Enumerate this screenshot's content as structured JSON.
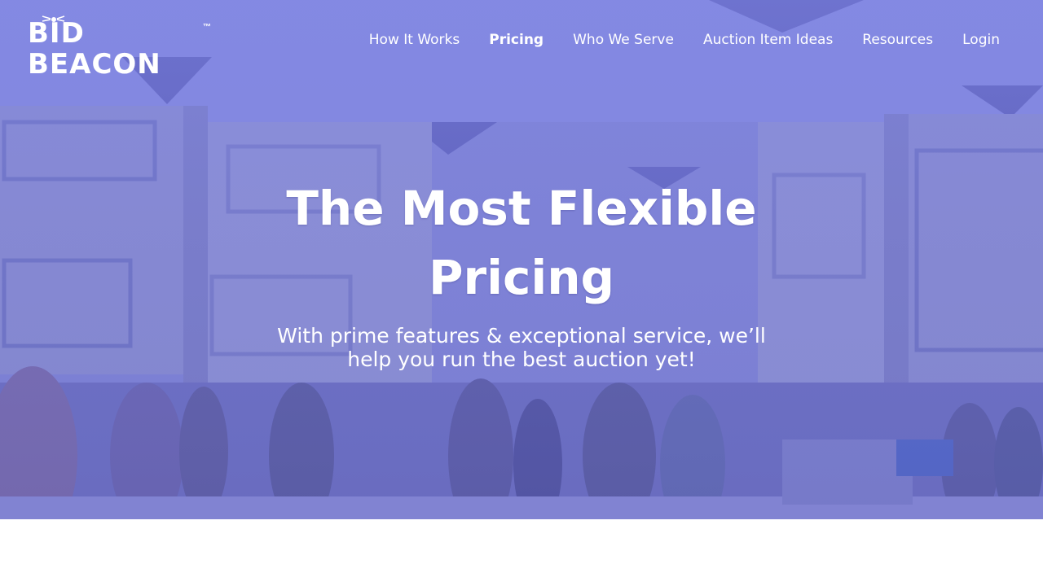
{
  "brand": {
    "logo_text": "BID BEACON",
    "trademark": "™"
  },
  "nav": {
    "items": [
      {
        "label": "How It Works",
        "active": false
      },
      {
        "label": "Pricing",
        "active": true
      },
      {
        "label": "Who We Serve",
        "active": false
      },
      {
        "label": "Auction Item Ideas",
        "active": false
      },
      {
        "label": "Resources",
        "active": false
      },
      {
        "label": "Login",
        "active": false
      }
    ]
  },
  "hero": {
    "headline_line1": "The Most Flexible",
    "headline_line2": "Pricing",
    "subheadline": "With prime features & exceptional service, we’ll help you run the best auction yet!",
    "overlay_color": "#7c80d6",
    "background_image": "banquet-hall-auction-photo"
  }
}
